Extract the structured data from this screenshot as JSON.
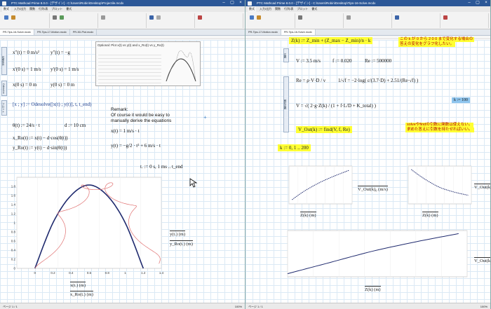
{
  "left_window": {
    "title": "PTC Mathcad Prime 8.0.0 - [デザイン] - C:\\Users\\Robin\\Desktop\\Projectile.mcdx",
    "doc_tabs": [
      "PR-Tips-16-Solve.mcdx",
      "PR-Tips-17-Motion.mcdx",
      "PR-3D-Plot.mcdx"
    ],
    "side_labels": [
      "初期条件",
      "Odesolve",
      "プロット"
    ],
    "eq": {
      "ode1": "x″(t) = 0 m/s²",
      "ode2": "y″(t) = −g",
      "ic1": "x′(0 s) = 1 m/s",
      "ic2": "y′(0 s) = 1 m/s",
      "ic3": "x(0 s) = 0 m",
      "ic4": "y(0 s) = 0 m",
      "solve": "[x ; y] := Odesolve([x(t) ; y(t)], t, t_end)",
      "theta": "θ(t) := 24/s · t",
      "d": "d := 10 cm",
      "xro": "x_Ro(t) := x(t) − d·cos(θ(t))",
      "yro": "y_Ro(t) := y(t) − d·sin(θ(t))",
      "range": "t. := 0 s, 1 ms .. t_end",
      "remark_x": "x(t) = 1 m/s · t",
      "remark_y": "y(t) = −g/2 · t² + 6 m/s · t"
    },
    "remark": [
      "Remark:",
      "Of course it would be easy to",
      "manually derive the equations"
    ],
    "optional_title": "Optional: Plot  x(t) vs  y(t)  and  x_Ro(t) vs  y_Ro(t)",
    "plot_labels": {
      "y1": "y(t.)  (m)",
      "y2": "y_Ro(t.)  (m)",
      "x1": "x(t.)  (m)",
      "x2": "x_Ro(t.)  (m)"
    },
    "plot_xticks": [
      "0",
      "0.2",
      "0.4",
      "0.6",
      "0.8",
      "1",
      "1.2",
      "1.4"
    ],
    "plot_yticks": [
      "1.8",
      "1.6",
      "1.4",
      "1.2",
      "1",
      "0.8",
      "0.6",
      "0.4",
      "0.2",
      "0"
    ],
    "status": "ページ 1 / 1",
    "zoom": "100%"
  },
  "right_window": {
    "title": "PTC Mathcad Prime 8.0.0 - [デザイン] - C:\\Users\\Robin\\Desktop\\Tips-16-Solve.mcdx",
    "doc_tabs": [
      "PR-Tips-17-Motion.mcdx",
      "PR-Tips-16-Solve.mcdx"
    ],
    "side_labels": [
      "定義",
      "解析定義"
    ],
    "eq": {
      "zk": "Z(k) := Z_min + (Z_max − Z_min)/n · k",
      "v": "V := 3.5 m/s",
      "f": "f := 0.020",
      "re0": "Re := 500000",
      "re": "Re = ρ·V·D / ν",
      "colebrook": "1/√f = −2·log( ε/(3.7·D) + 2.51/(Re·√f) )",
      "vform": "V = √( 2·g·Z(k) / (1 + f·L/D + K_total) )",
      "k": "k := 100",
      "find": "V_Out(k) := find(V, f, Re)",
      "krange": "k := 0, 1 .. 200"
    },
    "notes_jp": [
      "この k が 0 から 2 0 0 まで変化する場合の",
      "答えの変化をグラフ化したい。",
      "solveやfindの引数に関数は使えない。",
      "求めた答えに引数を持たせればいい。"
    ],
    "plot_labels": {
      "p1x": "Z(k)  (m)",
      "p1y": "V_Out(k)₀ (m/s)",
      "p2x": "Z(k)  (m)",
      "p2y": "V_Out(k)",
      "p3x": "Z(k)  (m)",
      "p3y": "V_Out(k)"
    },
    "status": "ページ 1 / 1",
    "zoom": "100%"
  },
  "colors": {
    "titlebar": "#2b5797",
    "trajectory": "#1f2a6e",
    "rotating": "#e07070",
    "highlight": "#ffff33",
    "note_red": "#b00000",
    "value_blue": "#8fc5ee"
  },
  "chart_data": [
    {
      "type": "line",
      "series": [
        {
          "name": "y(t.)  (m)",
          "x": [
            0,
            0.2,
            0.4,
            0.6,
            0.8,
            1.0,
            1.2
          ],
          "y": [
            0,
            1.0,
            1.6,
            1.83,
            1.6,
            1.0,
            0
          ]
        }
      ],
      "xlim": [
        -0.2,
        1.4
      ],
      "ylim": [
        0,
        2
      ]
    },
    {
      "type": "line",
      "series": [
        {
          "x": [
            0.1,
            0.5,
            1.0,
            1.5,
            2.0
          ],
          "y": [
            0.5,
            1.5,
            2.5,
            3.3,
            4.0
          ]
        }
      ]
    },
    {
      "type": "line",
      "series": [
        {
          "x": [
            0.1,
            0.5,
            1.0,
            1.5,
            2.0
          ],
          "y": [
            0.02,
            0.015,
            0.01,
            0.007,
            0.005
          ]
        }
      ]
    },
    {
      "type": "line",
      "series": [
        {
          "x": [
            0,
            0.5,
            1.0,
            1.5,
            2.0
          ],
          "y": [
            0.3,
            1.4,
            2.5,
            3.4,
            4.2
          ]
        }
      ]
    }
  ]
}
